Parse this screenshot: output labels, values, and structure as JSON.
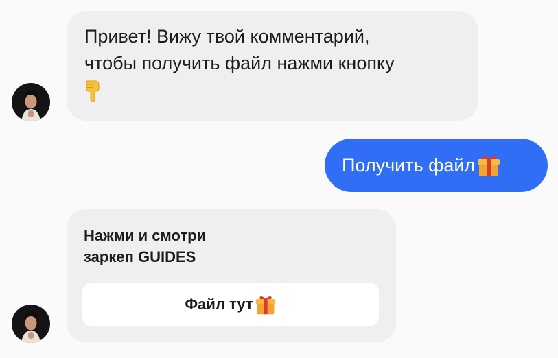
{
  "messages": {
    "greeting": {
      "line1": "Привет! Вижу твой комментарий,",
      "line2": "чтобы получить файл нажми кнопку",
      "emoji": "point-down-icon"
    },
    "reply": {
      "text": "Получить файл",
      "emoji": "gift-icon"
    },
    "card": {
      "line1": "Нажми и смотри",
      "line2": "заркеп GUIDES",
      "button_label": "Файл тут",
      "button_emoji": "gift-icon"
    }
  },
  "colors": {
    "background": "#fafafb",
    "incoming_bubble": "#efeff1",
    "outgoing_bubble": "#2f6ef5",
    "button_bg": "#ffffff",
    "text": "#1c1c1e"
  }
}
